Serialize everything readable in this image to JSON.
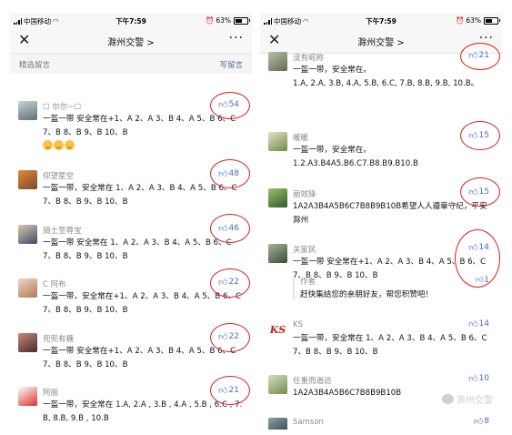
{
  "status": {
    "carrier": "中国移动",
    "time": "下午7:59",
    "battery": "63%"
  },
  "nav": {
    "close_label": "✕",
    "title": "滁州交警 >",
    "more_label": "···"
  },
  "left": {
    "section_title": "精选留言",
    "write_label": "写留言",
    "comments": [
      {
        "name": "☐ 尔尔~☐",
        "likes": "54",
        "text": "一盔一带 安全常在+1、A 2、A 3、B 4、A 5、B 6、C 7、B 8、B 9、B 10、B"
      },
      {
        "name": "仰望星空",
        "likes": "48",
        "text": "一盔一带，安全常在 1、A 2、A 3、B 4、A 5、B 6、C 7、B 8、B 9、B 10、B"
      },
      {
        "name": "骑士至尊宝",
        "likes": "46",
        "text": "一盔一带 安全常在 1、A 2、A 3、B 4、A 5、B 6、C 7、B 8、B 9、B 10、B"
      },
      {
        "name": "C 阿布",
        "likes": "22",
        "text": "一盔一带，安全常在+1、A 2、A 3、B 4、A 5、B 6、C 7、B 8、B 9、B 10、B"
      },
      {
        "name": "兜兜有糖",
        "likes": "22",
        "text": "一盔一带 安全常在+1、A 2、A 3、B 4、A 5、B 6、C 7、B 8、B 9、B 10、B"
      },
      {
        "name": "阿丽",
        "likes": "21",
        "text": "一盔一带，安全常在 1.A, 2.A , 3.B , 4.A , 5.B , 6.C , 7.B, 8.B, 9.B , 10.B"
      }
    ]
  },
  "right": {
    "comments": [
      {
        "name": "没有昵称",
        "likes": "21",
        "text": "一盔一带，安全常在。\n1.A, 2.A, 3.B, 4.A, 5.B, 6.C, 7.B, 8.B, 9.B, 10.B。"
      },
      {
        "name": "暖暖",
        "likes": "15",
        "text": "一盔一带，安全常在。\n1.2.A3.B4A5.B6.C7.B8.B9.B10.B"
      },
      {
        "name": "丽效锋",
        "likes": "15",
        "text": "1A2A3B4A5B6C7B8B9B10B希望人人遵章守纪，平安滁州"
      },
      {
        "name": "关家民",
        "likes": "14",
        "text": "一盔一带 安全常在+1、A 2、A 3、B 4、A 5、B 6、C 7、B 8、B 9、B 10、B"
      },
      {
        "name": "KS",
        "likes": "14",
        "text": "一盔一带，安全常在 1、A 2、A 3、B 4、A 5、B 6、C 7、B 8、B 9、B 10、B"
      },
      {
        "name": "任重而道远",
        "likes": "10",
        "text": "1A2A3B4A5B6C7B8B9B10B"
      },
      {
        "name": "Samson",
        "likes": "8",
        "text": ""
      }
    ],
    "reply": {
      "author": "作者",
      "text": "赶快集结您的亲朋好友，帮您积赞吧！",
      "likes": "1"
    },
    "watermark": "滁州交警"
  }
}
